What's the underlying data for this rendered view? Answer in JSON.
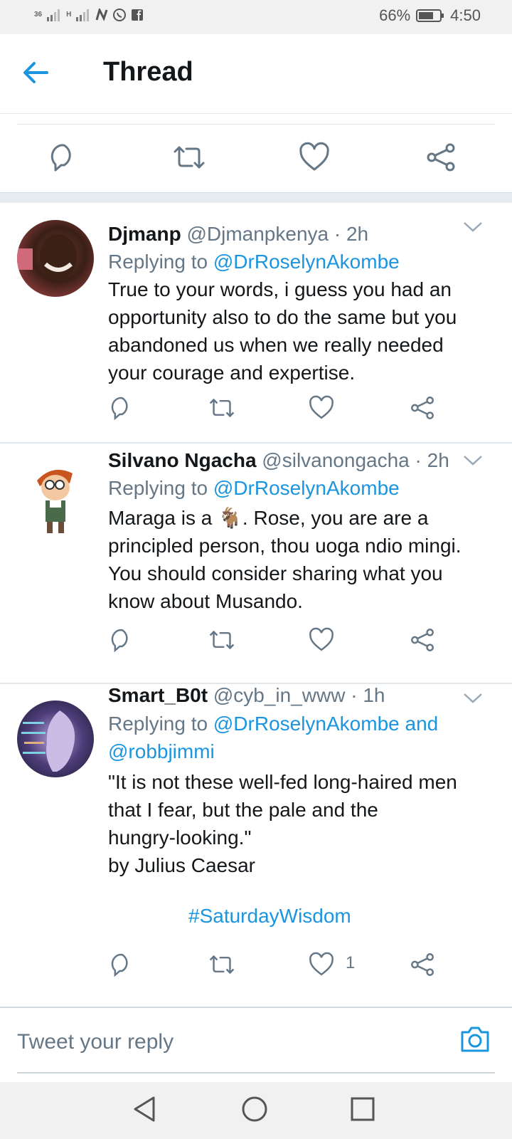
{
  "status_bar": {
    "network_1": "36",
    "network_2": "H",
    "battery": "66%",
    "time": "4:50",
    "icons": [
      "signal-icon",
      "n-icon",
      "whatsapp-icon",
      "facebook-icon",
      "battery-icon"
    ]
  },
  "header": {
    "title": "Thread",
    "back_icon": "back-arrow-icon"
  },
  "colors": {
    "accent": "#1b95e0",
    "text": "#14171a",
    "secondary": "#657786",
    "divider": "#e1e8ed"
  },
  "tweets": [
    {
      "name": "Djmanp",
      "handle_meta": "@Djmanpkenya · 2h",
      "replying_label": "Replying to",
      "mentions": [
        "@DrRoselynAkombe"
      ],
      "body_lines": [
        "True to your words, i guess you had an",
        "opportunity also to do the same but you",
        "abandoned us when we really needed",
        "your courage and expertise."
      ]
    },
    {
      "name": "Silvano Ngacha",
      "handle_meta": "@silvanongacha · 2h",
      "replying_label": "Replying to",
      "mentions": [
        "@DrRoselynAkombe"
      ],
      "body_lines": [
        "Maraga is a 🐐. Rose, you are are a",
        "principled person, thou uoga ndio mingi.",
        "You should consider sharing what you",
        "know about Musando."
      ]
    },
    {
      "name": "Smart_B0t",
      "handle_meta": "@cyb_in_www · 1h",
      "replying_label": "Replying to",
      "mentions": [
        "@DrRoselynAkombe and",
        "@robbjimmi"
      ],
      "body_lines": [
        "\"It is not these well-fed long-haired men",
        "that I fear, but the pale and the",
        "hungry-looking.\"",
        "by Julius Caesar"
      ],
      "hashtag": "#SaturdayWisdom",
      "like_count": "1"
    }
  ],
  "reply": {
    "placeholder": "Tweet your reply",
    "camera_icon": "camera-icon"
  },
  "nav": {
    "icons": [
      "nav-back-icon",
      "nav-home-icon",
      "nav-recents-icon"
    ]
  }
}
